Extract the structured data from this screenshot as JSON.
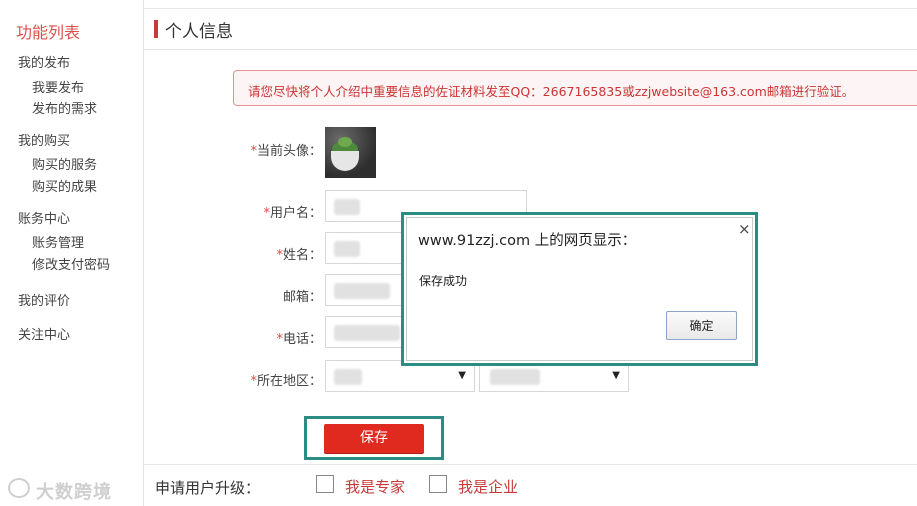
{
  "sidebar": {
    "title": "功能列表",
    "groups": [
      {
        "label": "我的发布",
        "items": [
          "我要发布",
          "发布的需求"
        ]
      },
      {
        "label": "我的购买",
        "items": [
          "购买的服务",
          "购买的成果"
        ]
      },
      {
        "label": "账务中心",
        "items": [
          "账务管理",
          "修改支付密码"
        ]
      },
      {
        "label": "我的评价",
        "items": []
      },
      {
        "label": "关注中心",
        "items": []
      }
    ]
  },
  "header": {
    "title": "个人信息"
  },
  "notice": {
    "text": "请您尽快将个人介绍中重要信息的佐证材料发至QQ：2667165835或zzjwebsite@163.com邮箱进行验证。"
  },
  "form": {
    "required_mark": "*",
    "avatar_label": "当前头像：",
    "username_label": "用户名：",
    "name_label": "姓名：",
    "email_label": "邮箱：",
    "phone_label": "电话：",
    "region_label": "所在地区：",
    "save_label": "保存"
  },
  "upgrade": {
    "label": "申请用户升级：",
    "options": [
      "我是专家",
      "我是企业"
    ]
  },
  "dialog": {
    "title": "www.91zzj.com 上的网页显示：",
    "message": "保存成功",
    "ok_label": "确定",
    "close_glyph": "×"
  },
  "watermark": {
    "text": "大数跨境"
  },
  "colors": {
    "accent": "#c63a3a",
    "save_button": "#e02a1f",
    "highlight_frame": "#2a8c83"
  }
}
